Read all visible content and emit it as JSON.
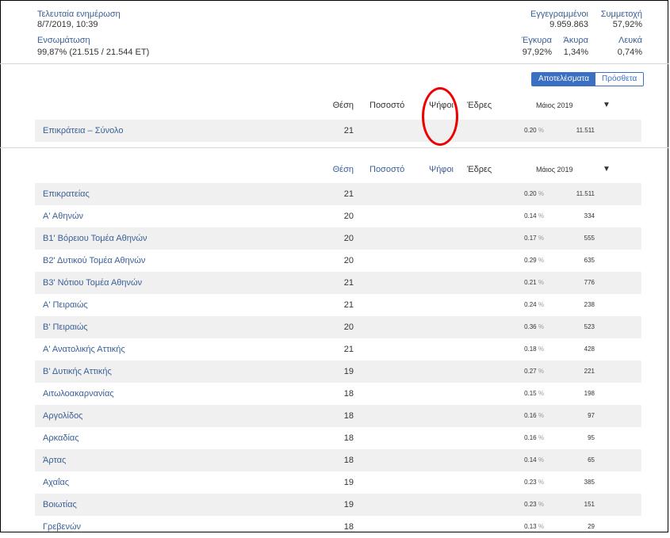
{
  "header": {
    "last_update_label": "Τελευταία ενημέρωση",
    "last_update_value": "8/7/2019, 10:39",
    "integration_label": "Ενσωμάτωση",
    "integration_value": "99,87% (21.515 / 21.544 ΕΤ)",
    "stats_top": [
      {
        "label": "Εγγεγραμμένοι",
        "value": "9.959.863"
      },
      {
        "label": "Συμμετοχή",
        "value": "57,92%"
      }
    ],
    "stats_bottom": [
      {
        "label": "Έγκυρα",
        "value": "97,92%"
      },
      {
        "label": "Άκυρα",
        "value": "1,34%"
      },
      {
        "label": "Λευκά",
        "value": "0,74%"
      }
    ]
  },
  "tabs": [
    {
      "label": "Αποτελέσματα",
      "active": true
    },
    {
      "label": "Πρόσθετα",
      "active": false
    }
  ],
  "columns": {
    "position": "Θέση",
    "percent": "Ποσοστό",
    "votes": "Ψήφοι",
    "seats": "Έδρες",
    "election": "Μάιος 2019",
    "dropdown_icon": "▼"
  },
  "summary": {
    "name": "Επικράτεια – Σύνολο",
    "position": "21",
    "percent": "0.20",
    "unit": "%",
    "seats": "11.511"
  },
  "rows": [
    {
      "name": "Επικρατείας",
      "position": "21",
      "percent": "0.20",
      "unit": "%",
      "seats": "11.511"
    },
    {
      "name": "Α' Αθηνών",
      "position": "20",
      "percent": "0.14",
      "unit": "%",
      "seats": "334"
    },
    {
      "name": "Β1' Βόρειου Τομέα Αθηνών",
      "position": "20",
      "percent": "0.17",
      "unit": "%",
      "seats": "555"
    },
    {
      "name": "Β2' Δυτικού Τομέα Αθηνών",
      "position": "20",
      "percent": "0.29",
      "unit": "%",
      "seats": "635"
    },
    {
      "name": "Β3' Νότιου Τομέα Αθηνών",
      "position": "21",
      "percent": "0.21",
      "unit": "%",
      "seats": "776"
    },
    {
      "name": "Α' Πειραιώς",
      "position": "21",
      "percent": "0.24",
      "unit": "%",
      "seats": "238"
    },
    {
      "name": "Β' Πειραιώς",
      "position": "20",
      "percent": "0.36",
      "unit": "%",
      "seats": "523"
    },
    {
      "name": "Α' Ανατολικής Αττικής",
      "position": "21",
      "percent": "0.18",
      "unit": "%",
      "seats": "428"
    },
    {
      "name": "Β' Δυτικής Αττικής",
      "position": "19",
      "percent": "0.27",
      "unit": "%",
      "seats": "221"
    },
    {
      "name": "Αιτωλοακαρνανίας",
      "position": "18",
      "percent": "0.15",
      "unit": "%",
      "seats": "198"
    },
    {
      "name": "Αργολίδος",
      "position": "18",
      "percent": "0.16",
      "unit": "%",
      "seats": "97"
    },
    {
      "name": "Αρκαδίας",
      "position": "18",
      "percent": "0.16",
      "unit": "%",
      "seats": "95"
    },
    {
      "name": "Άρτας",
      "position": "18",
      "percent": "0.14",
      "unit": "%",
      "seats": "65"
    },
    {
      "name": "Αχαΐας",
      "position": "19",
      "percent": "0.23",
      "unit": "%",
      "seats": "385"
    },
    {
      "name": "Βοιωτίας",
      "position": "19",
      "percent": "0.23",
      "unit": "%",
      "seats": "151"
    },
    {
      "name": "Γρεβενών",
      "position": "18",
      "percent": "0.13",
      "unit": "%",
      "seats": "29"
    }
  ],
  "colors": {
    "accent": "#3a6fc3",
    "link": "#3a5f96",
    "annotation": "#e00000",
    "row_shade": "#f0f0f0"
  }
}
